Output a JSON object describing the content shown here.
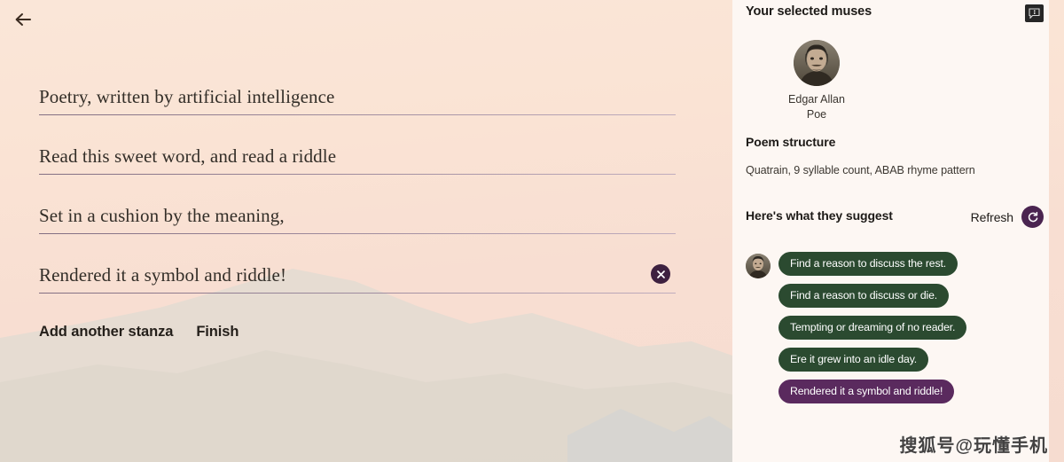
{
  "nav": {
    "back_icon": "arrow-left-icon"
  },
  "editor": {
    "lines": [
      {
        "text": "Poetry, written by artificial intelligence",
        "deletable": false
      },
      {
        "text": "Read this sweet word, and read a riddle",
        "deletable": false
      },
      {
        "text": "Set in a cushion by the meaning,",
        "deletable": false
      },
      {
        "text": "Rendered it a symbol and riddle!",
        "deletable": true
      }
    ],
    "delete_icon": "close-circle-icon",
    "actions": [
      {
        "label": "Add another stanza",
        "name": "add-another-stanza-button"
      },
      {
        "label": "Finish",
        "name": "finish-button"
      }
    ]
  },
  "sidebar": {
    "title": "Your selected muses",
    "info_icon": "info-bubble-icon",
    "muse": {
      "name_line_1": "Edgar Allan",
      "name_line_2": "Poe",
      "avatar_name": "edgar-allan-poe-avatar"
    },
    "structure": {
      "heading": "Poem structure",
      "description": "Quatrain, 9 syllable count, ABAB rhyme pattern"
    },
    "suggestions": {
      "heading": "Here's what they suggest",
      "refresh_label": "Refresh",
      "refresh_icon": "refresh-icon",
      "items": [
        {
          "text": "Find a reason to discuss the rest.",
          "state": "default"
        },
        {
          "text": "Find a reason to discuss or die.",
          "state": "default"
        },
        {
          "text": "Tempting or dreaming of no reader.",
          "state": "default"
        },
        {
          "text": "Ere it grew into an idle day.",
          "state": "default"
        },
        {
          "text": "Rendered it a symbol and riddle!",
          "state": "selected"
        }
      ]
    }
  },
  "watermark": {
    "text": "搜狐号@玩懂手机"
  },
  "colors": {
    "chip_default": "#2b4a30",
    "chip_selected": "#5a2a5e",
    "accent_purple": "#4a2450",
    "canvas": "#fae6d8",
    "panel": "#fdf7f3"
  }
}
